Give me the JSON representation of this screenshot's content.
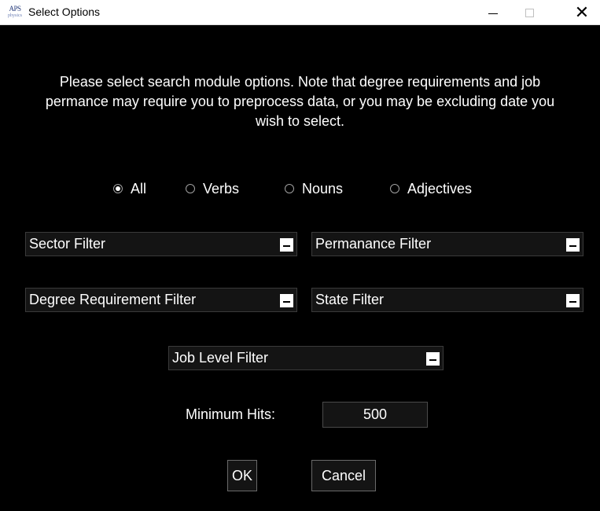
{
  "window": {
    "title": "Select Options",
    "icon": "aps-app-icon",
    "icon_text_line1": "APS",
    "icon_text_line2": "physics",
    "close_glyph": "✕"
  },
  "message": "Please select search module options. Note that degree requirements and job permance may require you to preprocess data, or you may be excluding date you wish to select.",
  "word_types": {
    "options": [
      {
        "label": "All",
        "checked": true
      },
      {
        "label": "Verbs",
        "checked": false
      },
      {
        "label": "Nouns",
        "checked": false
      },
      {
        "label": "Adjectives",
        "checked": false
      }
    ]
  },
  "filters": {
    "sector": "Sector Filter",
    "permanance": "Permanance Filter",
    "degree": "Degree Requirement Filter",
    "state": "State Filter",
    "job_level": "Job Level Filter"
  },
  "min_hits": {
    "label": "Minimum Hits:",
    "value": "500"
  },
  "buttons": {
    "ok": "OK",
    "cancel": "Cancel"
  },
  "colors": {
    "background": "#000000",
    "titlebar": "#ffffff",
    "text": "#ffffff",
    "field": "#141414"
  }
}
